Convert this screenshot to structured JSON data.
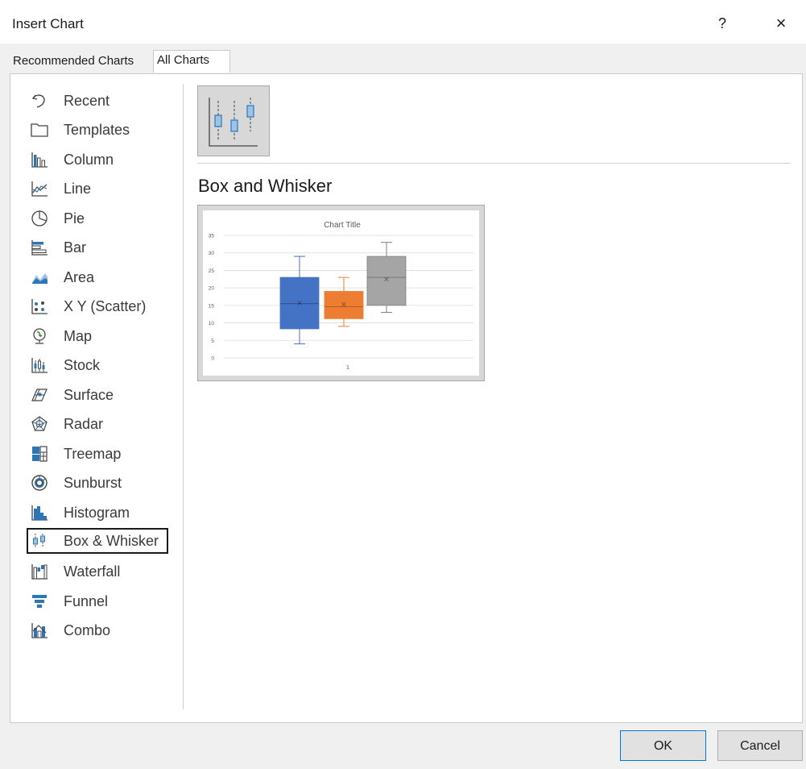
{
  "window": {
    "title": "Insert Chart",
    "help": "?",
    "close": "×"
  },
  "tabs": [
    {
      "label": "Recommended Charts"
    },
    {
      "label": "All Charts"
    }
  ],
  "categories": [
    {
      "label": "Recent",
      "icon": "recent-icon"
    },
    {
      "label": "Templates",
      "icon": "folder-icon"
    },
    {
      "label": "Column",
      "icon": "column-chart-icon"
    },
    {
      "label": "Line",
      "icon": "line-chart-icon"
    },
    {
      "label": "Pie",
      "icon": "pie-chart-icon"
    },
    {
      "label": "Bar",
      "icon": "bar-chart-icon"
    },
    {
      "label": "Area",
      "icon": "area-chart-icon"
    },
    {
      "label": "X Y (Scatter)",
      "icon": "scatter-chart-icon"
    },
    {
      "label": "Map",
      "icon": "map-globe-icon"
    },
    {
      "label": "Stock",
      "icon": "stock-chart-icon"
    },
    {
      "label": "Surface",
      "icon": "surface-chart-icon"
    },
    {
      "label": "Radar",
      "icon": "radar-chart-icon"
    },
    {
      "label": "Treemap",
      "icon": "treemap-icon"
    },
    {
      "label": "Sunburst",
      "icon": "sunburst-icon"
    },
    {
      "label": "Histogram",
      "icon": "histogram-icon"
    },
    {
      "label": "Box & Whisker",
      "icon": "box-whisker-icon",
      "selected": true
    },
    {
      "label": "Waterfall",
      "icon": "waterfall-icon"
    },
    {
      "label": "Funnel",
      "icon": "funnel-icon"
    },
    {
      "label": "Combo",
      "icon": "combo-chart-icon"
    }
  ],
  "main": {
    "heading": "Box and Whisker"
  },
  "chart_data": {
    "type": "box",
    "title": "Chart Title",
    "categories": [
      "1"
    ],
    "yticks": [
      "0",
      "5",
      "10",
      "15",
      "20",
      "25",
      "30",
      "35"
    ],
    "ylim": [
      0,
      35
    ],
    "grid": true,
    "series": [
      {
        "min": 4,
        "q1": 8.3,
        "median": 15.5,
        "mean": 15.7,
        "q3": 23,
        "max": 29,
        "color": "#4472c4"
      },
      {
        "min": 9,
        "q1": 11.2,
        "median": 14.6,
        "mean": 15.3,
        "q3": 19,
        "max": 23,
        "color": "#ed7d31"
      },
      {
        "min": 13,
        "q1": 15,
        "median": 23,
        "mean": 22.5,
        "q3": 29,
        "max": 33,
        "color": "#a5a5a5"
      }
    ]
  },
  "buttons": {
    "ok": "OK",
    "cancel": "Cancel"
  },
  "colors": {
    "accent": "#0078d7",
    "icon_blue": "#2e75b6"
  }
}
